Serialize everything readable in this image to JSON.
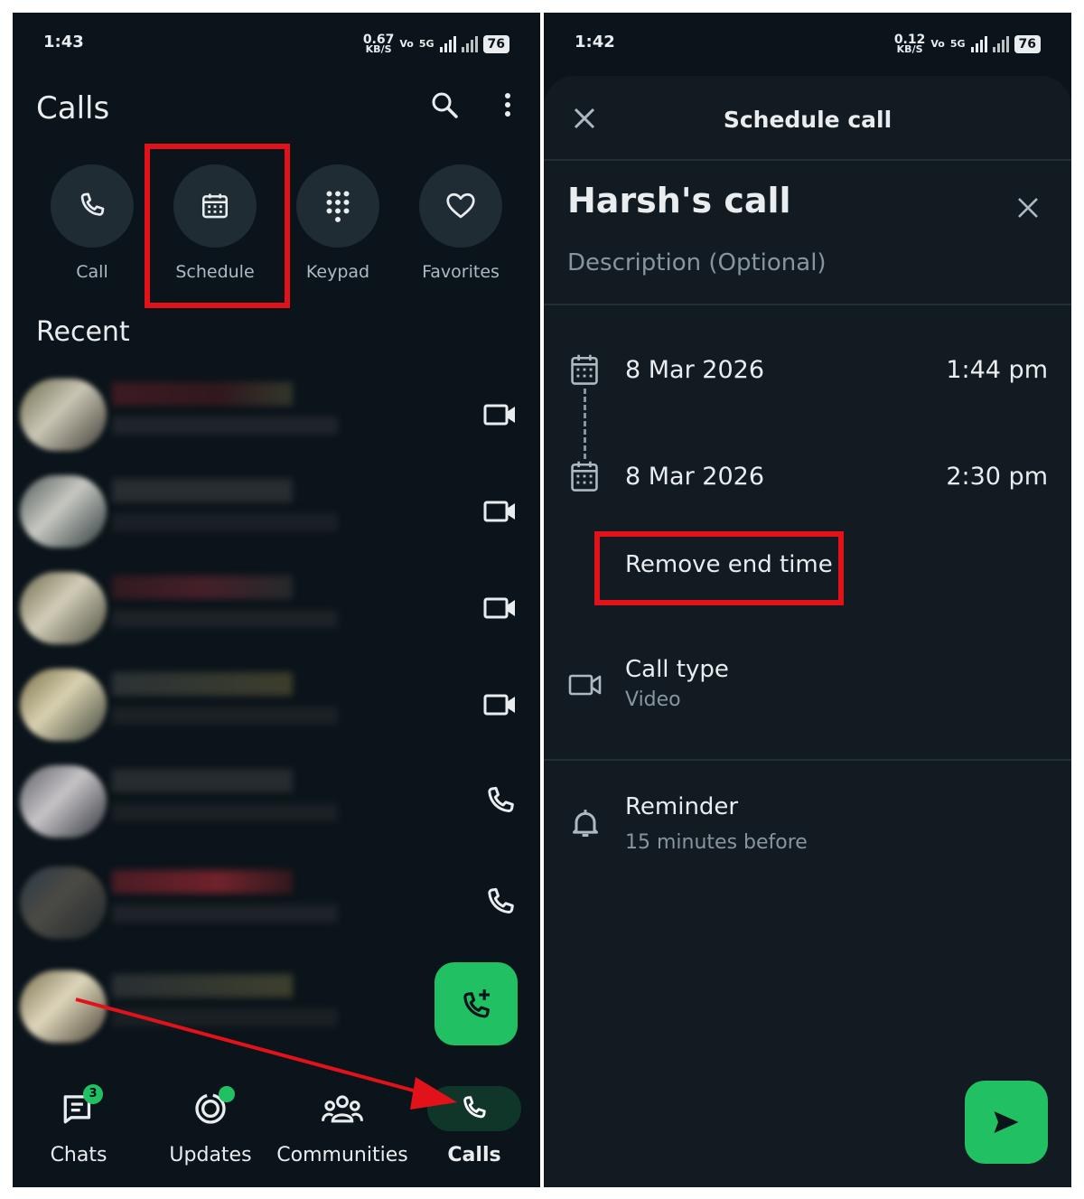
{
  "left": {
    "status": {
      "time": "1:43",
      "net_speed": "0.67",
      "net_unit": "KB/S",
      "vo": "Vo",
      "lte": "5G",
      "battery": "76"
    },
    "title": "Calls",
    "quick_actions": [
      "Call",
      "Schedule",
      "Keypad",
      "Favorites"
    ],
    "recent_label": "Recent",
    "recent_calls": [
      {
        "type": "video"
      },
      {
        "type": "video"
      },
      {
        "type": "video"
      },
      {
        "type": "video"
      },
      {
        "type": "voice"
      },
      {
        "type": "voice"
      },
      {
        "type": "none"
      }
    ],
    "nav": {
      "chats": "Chats",
      "chats_badge": "3",
      "updates": "Updates",
      "communities": "Communities",
      "calls": "Calls"
    }
  },
  "right": {
    "status": {
      "time": "1:42",
      "net_speed": "0.12",
      "net_unit": "KB/S",
      "vo": "Vo",
      "lte": "5G",
      "battery": "76"
    },
    "sheet_title": "Schedule call",
    "call_name": "Harsh's call",
    "description_placeholder": "Description (Optional)",
    "start": {
      "date": "8 Mar 2026",
      "time": "1:44 pm"
    },
    "end": {
      "date": "8 Mar 2026",
      "time": "2:30 pm"
    },
    "remove_end_time": "Remove end time",
    "call_type_label": "Call type",
    "call_type_value": "Video",
    "reminder_label": "Reminder",
    "reminder_value": "15 minutes before"
  },
  "colors": {
    "accent": "#21c063",
    "highlight": "#e2121b",
    "background": "#0b141a"
  }
}
